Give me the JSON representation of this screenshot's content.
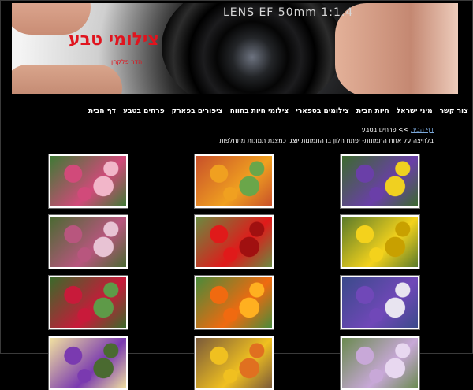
{
  "header": {
    "lens_text": "LENS EF 50mm 1:1.4",
    "site_title": "צילומי טבע",
    "site_subtitle": "הדר פלקהן"
  },
  "nav": {
    "items": [
      "דף הבית",
      "פרחים בטבע",
      "ציפורים בפארק",
      "צילומי חיות בחווה",
      "צילומים בספארי",
      "חיות הבית",
      "מיני ישראל",
      "צור קשר"
    ]
  },
  "breadcrumb": {
    "home": "דף הבית",
    "separator": ">>",
    "current": "פרחים בטבע"
  },
  "instructions": "בלחיצה על אחת התמונות- יפתח חלון בו התמונות יוצגו כמצגת תמונות מתחלפות",
  "gallery": {
    "thumbnails": [
      {
        "name": "pink-white-flowers",
        "colors": [
          "#d14a7a",
          "#f2b6c9",
          "#3f7a35"
        ]
      },
      {
        "name": "orange-flowers-green",
        "colors": [
          "#f0a020",
          "#6aa64a",
          "#c8502a"
        ]
      },
      {
        "name": "purple-yellow-pansies",
        "colors": [
          "#6a3fa8",
          "#f0d020",
          "#3c6a2e"
        ]
      },
      {
        "name": "pink-cluster-flowers",
        "colors": [
          "#b8567e",
          "#e8c3d4",
          "#4a6a32"
        ]
      },
      {
        "name": "red-hibiscus",
        "colors": [
          "#e01a1a",
          "#a01010",
          "#6a8a40"
        ]
      },
      {
        "name": "yellow-pansies",
        "colors": [
          "#f4d21c",
          "#c8a000",
          "#5a7a2a"
        ]
      },
      {
        "name": "red-spike-flowers",
        "colors": [
          "#c81a3a",
          "#5e9a48",
          "#3a6a2a"
        ]
      },
      {
        "name": "orange-nasturtium",
        "colors": [
          "#f06a10",
          "#ffb020",
          "#4a8a3a"
        ]
      },
      {
        "name": "purple-white-pansies",
        "colors": [
          "#7048b8",
          "#e8e4f0",
          "#3a4a8a"
        ]
      },
      {
        "name": "purple-iris-row",
        "colors": [
          "#7a3ab0",
          "#4a6a30",
          "#f0e0a0"
        ]
      },
      {
        "name": "yellow-orange-row",
        "colors": [
          "#f0c020",
          "#e07020",
          "#7a5a3a"
        ]
      },
      {
        "name": "lilac-flowers-row",
        "colors": [
          "#c8a8d8",
          "#e8d8f0",
          "#6a8a50"
        ]
      }
    ]
  }
}
